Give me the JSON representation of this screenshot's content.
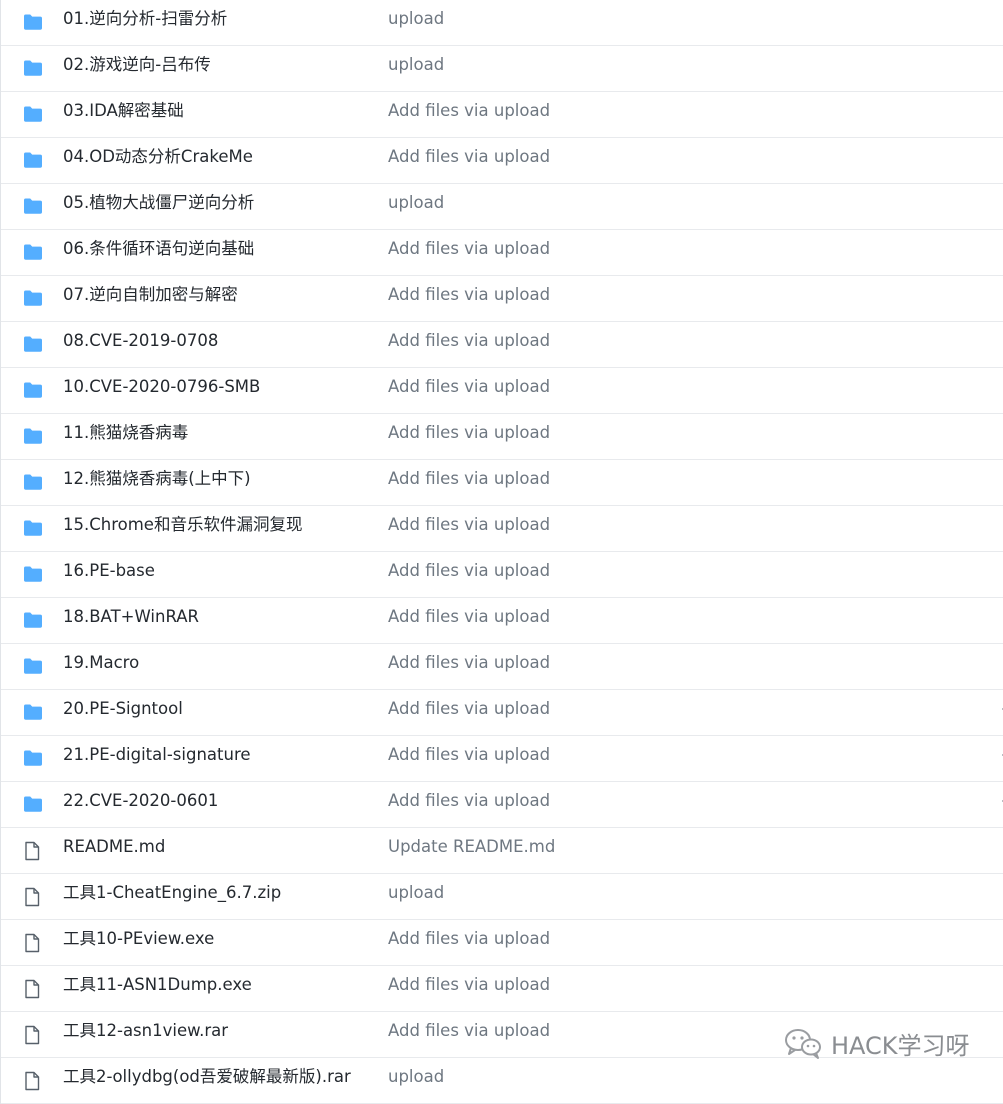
{
  "file_list": {
    "rows": [
      {
        "type": "folder",
        "icon": "folder-icon",
        "name": "01.逆向分析-扫雷分析",
        "commit": "upload"
      },
      {
        "type": "folder",
        "icon": "folder-icon",
        "name": "02.游戏逆向-吕布传",
        "commit": "upload"
      },
      {
        "type": "folder",
        "icon": "folder-icon",
        "name": "03.IDA解密基础",
        "commit": "Add files via upload"
      },
      {
        "type": "folder",
        "icon": "folder-icon",
        "name": "04.OD动态分析CrakeMe",
        "commit": "Add files via upload"
      },
      {
        "type": "folder",
        "icon": "folder-icon",
        "name": "05.植物大战僵尸逆向分析",
        "commit": "upload"
      },
      {
        "type": "folder",
        "icon": "folder-icon",
        "name": "06.条件循环语句逆向基础",
        "commit": "Add files via upload"
      },
      {
        "type": "folder",
        "icon": "folder-icon",
        "name": "07.逆向自制加密与解密",
        "commit": "Add files via upload"
      },
      {
        "type": "folder",
        "icon": "folder-icon",
        "name": "08.CVE-2019-0708",
        "commit": "Add files via upload"
      },
      {
        "type": "folder",
        "icon": "folder-icon",
        "name": "10.CVE-2020-0796-SMB",
        "commit": "Add files via upload"
      },
      {
        "type": "folder",
        "icon": "folder-icon",
        "name": "11.熊猫烧香病毒",
        "commit": "Add files via upload"
      },
      {
        "type": "folder",
        "icon": "folder-icon",
        "name": "12.熊猫烧香病毒(上中下)",
        "commit": "Add files via upload"
      },
      {
        "type": "folder",
        "icon": "folder-icon",
        "name": "15.Chrome和音乐软件漏洞复现",
        "commit": "Add files via upload"
      },
      {
        "type": "folder",
        "icon": "folder-icon",
        "name": "16.PE-base",
        "commit": "Add files via upload"
      },
      {
        "type": "folder",
        "icon": "folder-icon",
        "name": "18.BAT+WinRAR",
        "commit": "Add files via upload"
      },
      {
        "type": "folder",
        "icon": "folder-icon",
        "name": "19.Macro",
        "commit": "Add files via upload"
      },
      {
        "type": "folder",
        "icon": "folder-icon",
        "name": "20.PE-Signtool",
        "commit": "Add files via upload"
      },
      {
        "type": "folder",
        "icon": "folder-icon",
        "name": "21.PE-digital-signature",
        "commit": "Add files via upload"
      },
      {
        "type": "folder",
        "icon": "folder-icon",
        "name": "22.CVE-2020-0601",
        "commit": "Add files via upload"
      },
      {
        "type": "file",
        "icon": "file-icon",
        "name": "README.md",
        "commit": "Update README.md"
      },
      {
        "type": "file",
        "icon": "file-icon",
        "name": "工具1-CheatEngine_6.7.zip",
        "commit": "upload"
      },
      {
        "type": "file",
        "icon": "file-icon",
        "name": "工具10-PEview.exe",
        "commit": "Add files via upload"
      },
      {
        "type": "file",
        "icon": "file-icon",
        "name": "工具11-ASN1Dump.exe",
        "commit": "Add files via upload"
      },
      {
        "type": "file",
        "icon": "file-icon",
        "name": "工具12-asn1view.rar",
        "commit": "Add files via upload"
      },
      {
        "type": "file",
        "icon": "file-icon",
        "name": "工具2-ollydbg(od吾爱破解最新版).rar",
        "commit": "upload"
      }
    ]
  },
  "colors": {
    "folder": "#54aeff",
    "file_outline": "#57606a",
    "name_text": "#24292f",
    "commit_text": "#6e7781",
    "row_border": "#e8eaed"
  },
  "watermark": {
    "icon": "wechat-icon",
    "text": "HACK学习呀"
  }
}
